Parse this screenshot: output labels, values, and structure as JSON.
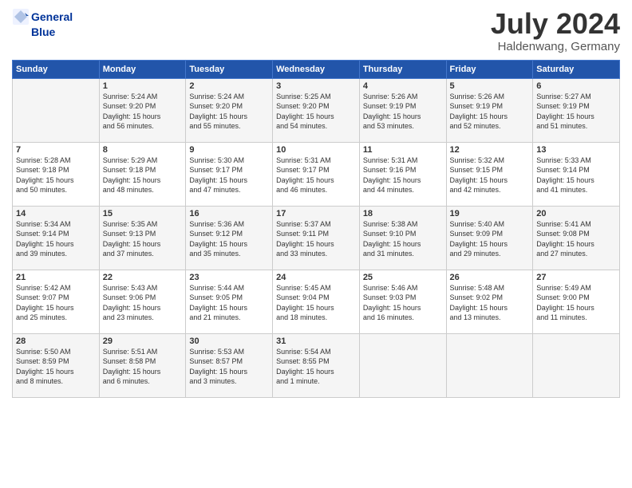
{
  "header": {
    "logo_line1": "General",
    "logo_line2": "Blue",
    "month_year": "July 2024",
    "location": "Haldenwang, Germany"
  },
  "days_of_week": [
    "Sunday",
    "Monday",
    "Tuesday",
    "Wednesday",
    "Thursday",
    "Friday",
    "Saturday"
  ],
  "weeks": [
    [
      {
        "day": "",
        "info": ""
      },
      {
        "day": "1",
        "info": "Sunrise: 5:24 AM\nSunset: 9:20 PM\nDaylight: 15 hours\nand 56 minutes."
      },
      {
        "day": "2",
        "info": "Sunrise: 5:24 AM\nSunset: 9:20 PM\nDaylight: 15 hours\nand 55 minutes."
      },
      {
        "day": "3",
        "info": "Sunrise: 5:25 AM\nSunset: 9:20 PM\nDaylight: 15 hours\nand 54 minutes."
      },
      {
        "day": "4",
        "info": "Sunrise: 5:26 AM\nSunset: 9:19 PM\nDaylight: 15 hours\nand 53 minutes."
      },
      {
        "day": "5",
        "info": "Sunrise: 5:26 AM\nSunset: 9:19 PM\nDaylight: 15 hours\nand 52 minutes."
      },
      {
        "day": "6",
        "info": "Sunrise: 5:27 AM\nSunset: 9:19 PM\nDaylight: 15 hours\nand 51 minutes."
      }
    ],
    [
      {
        "day": "7",
        "info": "Sunrise: 5:28 AM\nSunset: 9:18 PM\nDaylight: 15 hours\nand 50 minutes."
      },
      {
        "day": "8",
        "info": "Sunrise: 5:29 AM\nSunset: 9:18 PM\nDaylight: 15 hours\nand 48 minutes."
      },
      {
        "day": "9",
        "info": "Sunrise: 5:30 AM\nSunset: 9:17 PM\nDaylight: 15 hours\nand 47 minutes."
      },
      {
        "day": "10",
        "info": "Sunrise: 5:31 AM\nSunset: 9:17 PM\nDaylight: 15 hours\nand 46 minutes."
      },
      {
        "day": "11",
        "info": "Sunrise: 5:31 AM\nSunset: 9:16 PM\nDaylight: 15 hours\nand 44 minutes."
      },
      {
        "day": "12",
        "info": "Sunrise: 5:32 AM\nSunset: 9:15 PM\nDaylight: 15 hours\nand 42 minutes."
      },
      {
        "day": "13",
        "info": "Sunrise: 5:33 AM\nSunset: 9:14 PM\nDaylight: 15 hours\nand 41 minutes."
      }
    ],
    [
      {
        "day": "14",
        "info": "Sunrise: 5:34 AM\nSunset: 9:14 PM\nDaylight: 15 hours\nand 39 minutes."
      },
      {
        "day": "15",
        "info": "Sunrise: 5:35 AM\nSunset: 9:13 PM\nDaylight: 15 hours\nand 37 minutes."
      },
      {
        "day": "16",
        "info": "Sunrise: 5:36 AM\nSunset: 9:12 PM\nDaylight: 15 hours\nand 35 minutes."
      },
      {
        "day": "17",
        "info": "Sunrise: 5:37 AM\nSunset: 9:11 PM\nDaylight: 15 hours\nand 33 minutes."
      },
      {
        "day": "18",
        "info": "Sunrise: 5:38 AM\nSunset: 9:10 PM\nDaylight: 15 hours\nand 31 minutes."
      },
      {
        "day": "19",
        "info": "Sunrise: 5:40 AM\nSunset: 9:09 PM\nDaylight: 15 hours\nand 29 minutes."
      },
      {
        "day": "20",
        "info": "Sunrise: 5:41 AM\nSunset: 9:08 PM\nDaylight: 15 hours\nand 27 minutes."
      }
    ],
    [
      {
        "day": "21",
        "info": "Sunrise: 5:42 AM\nSunset: 9:07 PM\nDaylight: 15 hours\nand 25 minutes."
      },
      {
        "day": "22",
        "info": "Sunrise: 5:43 AM\nSunset: 9:06 PM\nDaylight: 15 hours\nand 23 minutes."
      },
      {
        "day": "23",
        "info": "Sunrise: 5:44 AM\nSunset: 9:05 PM\nDaylight: 15 hours\nand 21 minutes."
      },
      {
        "day": "24",
        "info": "Sunrise: 5:45 AM\nSunset: 9:04 PM\nDaylight: 15 hours\nand 18 minutes."
      },
      {
        "day": "25",
        "info": "Sunrise: 5:46 AM\nSunset: 9:03 PM\nDaylight: 15 hours\nand 16 minutes."
      },
      {
        "day": "26",
        "info": "Sunrise: 5:48 AM\nSunset: 9:02 PM\nDaylight: 15 hours\nand 13 minutes."
      },
      {
        "day": "27",
        "info": "Sunrise: 5:49 AM\nSunset: 9:00 PM\nDaylight: 15 hours\nand 11 minutes."
      }
    ],
    [
      {
        "day": "28",
        "info": "Sunrise: 5:50 AM\nSunset: 8:59 PM\nDaylight: 15 hours\nand 8 minutes."
      },
      {
        "day": "29",
        "info": "Sunrise: 5:51 AM\nSunset: 8:58 PM\nDaylight: 15 hours\nand 6 minutes."
      },
      {
        "day": "30",
        "info": "Sunrise: 5:53 AM\nSunset: 8:57 PM\nDaylight: 15 hours\nand 3 minutes."
      },
      {
        "day": "31",
        "info": "Sunrise: 5:54 AM\nSunset: 8:55 PM\nDaylight: 15 hours\nand 1 minute."
      },
      {
        "day": "",
        "info": ""
      },
      {
        "day": "",
        "info": ""
      },
      {
        "day": "",
        "info": ""
      }
    ]
  ]
}
